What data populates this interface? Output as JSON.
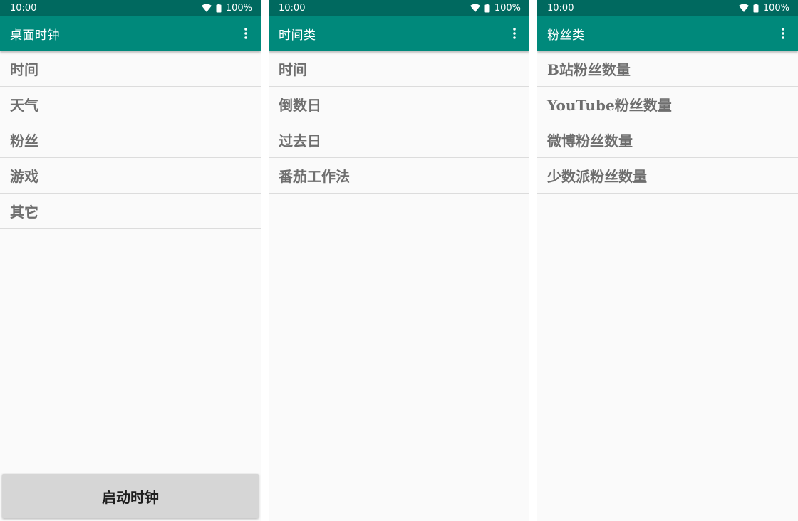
{
  "colors": {
    "status_bar": "#00695f",
    "app_bar": "#00897b",
    "list_text": "#6e6e6e",
    "divider": "#dcdcdc",
    "background": "#fafafa",
    "button_bg": "#d6d6d6"
  },
  "status_bar": {
    "time": "10:00",
    "battery": "100%",
    "icons": [
      "wifi-icon",
      "battery-icon"
    ]
  },
  "screens": [
    {
      "title": "桌面时钟",
      "items": [
        "时间",
        "天气",
        "粉丝",
        "游戏",
        "其它"
      ],
      "button_label": "启动时钟"
    },
    {
      "title": "时间类",
      "items": [
        "时间",
        "倒数日",
        "过去日",
        "番茄工作法"
      ]
    },
    {
      "title": "粉丝类",
      "items": [
        "B站粉丝数量",
        "YouTube粉丝数量",
        "微博粉丝数量",
        "少数派粉丝数量"
      ]
    }
  ]
}
